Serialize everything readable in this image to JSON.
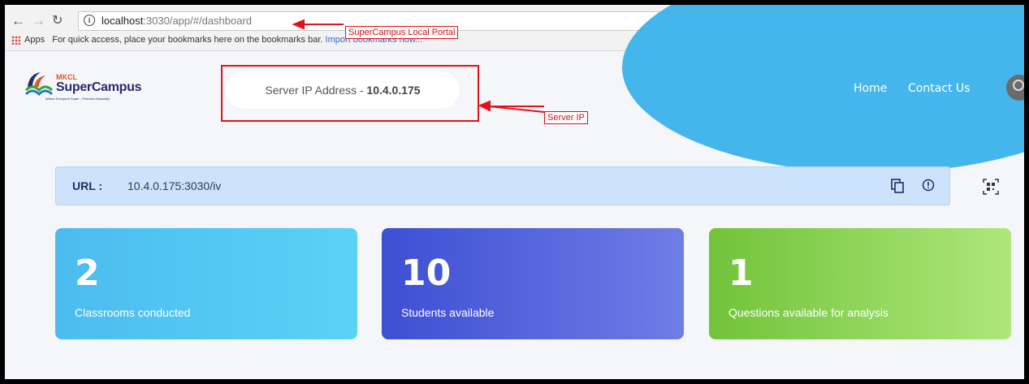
{
  "browser": {
    "url_host": "localhost",
    "url_path": ":3030/app/#/dashboard",
    "bookmarks_bar": {
      "apps_label": "Apps",
      "hint_text": "For quick access, place your bookmarks here on the bookmarks bar.",
      "import_link": "Import bookmarks now..."
    },
    "extension_letter": "G"
  },
  "header": {
    "logo": {
      "mkcl": "MKCL",
      "name": "SuperCampus",
      "tagline": "Where Everyone Super - Performs Naturally!"
    },
    "server_label": "Server IP Address - ",
    "server_ip": "10.4.0.175",
    "nav": {
      "home": "Home",
      "contact": "Contact Us"
    }
  },
  "url_strip": {
    "label": "URL :",
    "value": "10.4.0.175:3030/iv"
  },
  "cards": [
    {
      "number": "2",
      "caption": "Classrooms conducted"
    },
    {
      "number": "10",
      "caption": "Students available"
    },
    {
      "number": "1",
      "caption": "Questions available for analysis"
    }
  ],
  "annotations": {
    "portal_label": "SuperCampus Local Portal",
    "server_label": "Server IP"
  },
  "colors": {
    "accent": "#45b6ec",
    "annotation": "#e2121b",
    "card1": "#4cbcef",
    "card2": "#3d4fd3",
    "card3": "#71c33a"
  }
}
